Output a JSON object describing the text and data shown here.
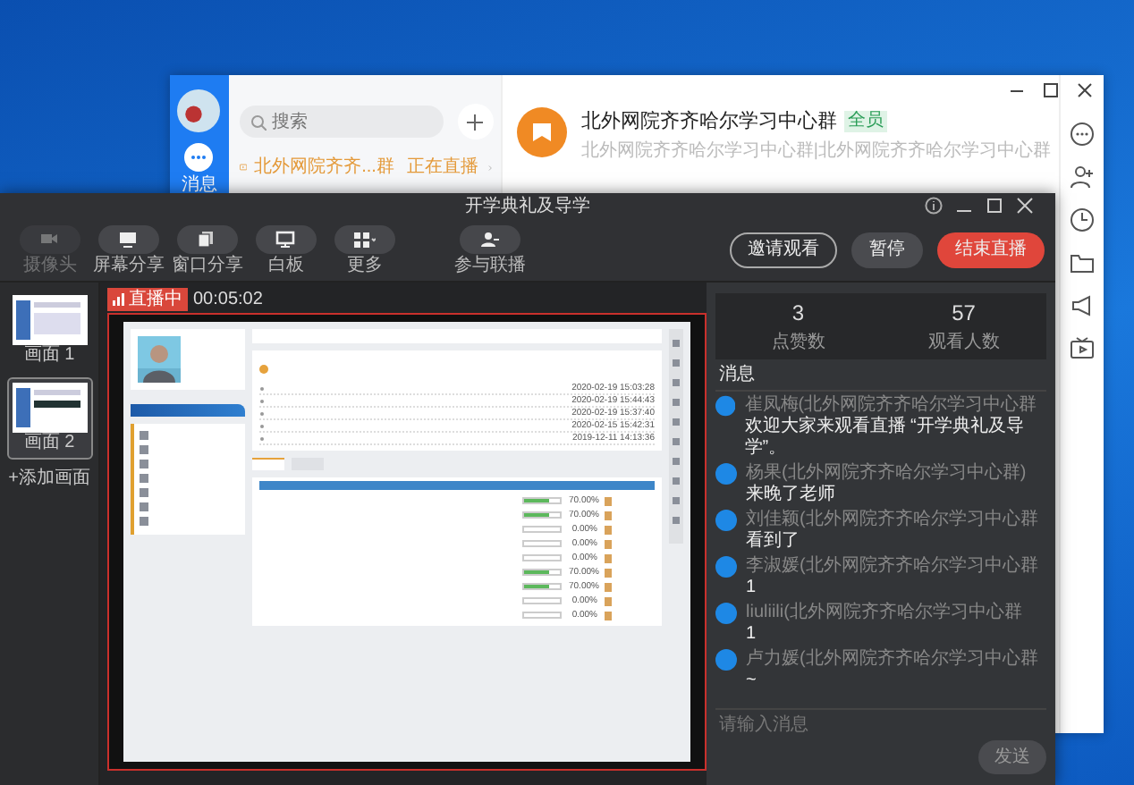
{
  "chat_window": {
    "sidebar": {
      "label": "消息"
    },
    "search": {
      "placeholder": "搜索"
    },
    "sessions": [
      {
        "title": "北外网院齐齐...群",
        "status": "正在直播"
      }
    ],
    "header": {
      "title": "北外网院齐齐哈尔学习中心群",
      "tag": "全员",
      "subtitle": "北外网院齐齐哈尔学习中心群|北外网院齐齐哈尔学习中心群"
    }
  },
  "live_window": {
    "title": "开学典礼及导学",
    "tools": [
      {
        "label": "摄像头",
        "kind": "camera",
        "disabled": true
      },
      {
        "label": "屏幕分享",
        "kind": "screen",
        "disabled": false
      },
      {
        "label": "窗口分享",
        "kind": "window",
        "disabled": false
      },
      {
        "label": "白板",
        "kind": "whiteboard",
        "disabled": false
      },
      {
        "label": "更多",
        "kind": "more",
        "disabled": false
      },
      {
        "label": "参与联播",
        "kind": "guest",
        "disabled": false
      }
    ],
    "actions": [
      {
        "label": "邀请观看",
        "kind": "outline"
      },
      {
        "label": "暂停",
        "kind": "plain"
      },
      {
        "label": "结束直播",
        "kind": "danger"
      }
    ],
    "scenes": [
      {
        "label": "画面 1",
        "selected": false
      },
      {
        "label": "画面 2",
        "selected": true
      }
    ],
    "add_scene": "+添加画面",
    "status": {
      "label": "直播中",
      "time": "00:05:02"
    },
    "shared_screen": {
      "announcements": [
        {
          "date": "2020-02-19 15:03:28"
        },
        {
          "date": "2020-02-19 15:44:43"
        },
        {
          "date": "2020-02-19 15:37:40"
        },
        {
          "date": "2020-02-15 15:42:31"
        },
        {
          "date": "2019-12-11 14:13:36"
        }
      ],
      "courses": [
        {
          "level": 0.7,
          "percent": "70.00%"
        },
        {
          "level": 0.7,
          "percent": "70.00%"
        },
        {
          "level": 0,
          "percent": "0.00%"
        },
        {
          "level": 0,
          "percent": "0.00%"
        },
        {
          "level": 0,
          "percent": "0.00%"
        },
        {
          "level": 0.7,
          "percent": "70.00%"
        },
        {
          "level": 0.7,
          "percent": "70.00%"
        },
        {
          "level": 0,
          "percent": "0.00%"
        },
        {
          "level": 0,
          "percent": "0.00%"
        }
      ]
    },
    "stats": [
      {
        "value": "3",
        "label": "点赞数"
      },
      {
        "value": "57",
        "label": "观看人数"
      }
    ],
    "messages_title": "消息",
    "messages": [
      {
        "sender": "崔凤梅(北外网院齐齐哈尔学习中心群",
        "text": "欢迎大家来观看直播 “开学典礼及导学”。"
      },
      {
        "sender": "杨果(北外网院齐齐哈尔学习中心群)",
        "text": "来晚了老师"
      },
      {
        "sender": "刘佳颖(北外网院齐齐哈尔学习中心群",
        "text": "看到了"
      },
      {
        "sender": "李淑媛(北外网院齐齐哈尔学习中心群",
        "text": "1"
      },
      {
        "sender": "liuliili(北外网院齐齐哈尔学习中心群",
        "text": "1"
      },
      {
        "sender": "卢力媛(北外网院齐齐哈尔学习中心群",
        "text": "~"
      }
    ],
    "input": {
      "placeholder": "请输入消息"
    },
    "send": "发送"
  }
}
